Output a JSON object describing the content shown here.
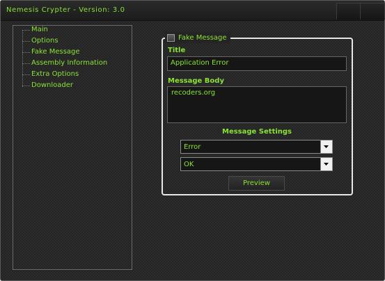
{
  "window": {
    "title": "Nemesis Crypter - Version: 3.0"
  },
  "nav": {
    "items": [
      {
        "label": "Main"
      },
      {
        "label": "Options"
      },
      {
        "label": "Fake Message"
      },
      {
        "label": "Assembly Information"
      },
      {
        "label": "Extra Options"
      },
      {
        "label": "Downloader"
      }
    ]
  },
  "fake_message": {
    "group_label": "Fake Message",
    "enabled": false,
    "title_label": "Title",
    "title_value": "Application Error",
    "body_label": "Message Body",
    "body_value": "recoders.org",
    "settings_label": "Message Settings",
    "icon_select_value": "Error",
    "buttons_select_value": "OK",
    "preview_label": "Preview"
  },
  "colors": {
    "accent": "#8ae234",
    "background": "#242424",
    "border": "#e8e8e8"
  }
}
